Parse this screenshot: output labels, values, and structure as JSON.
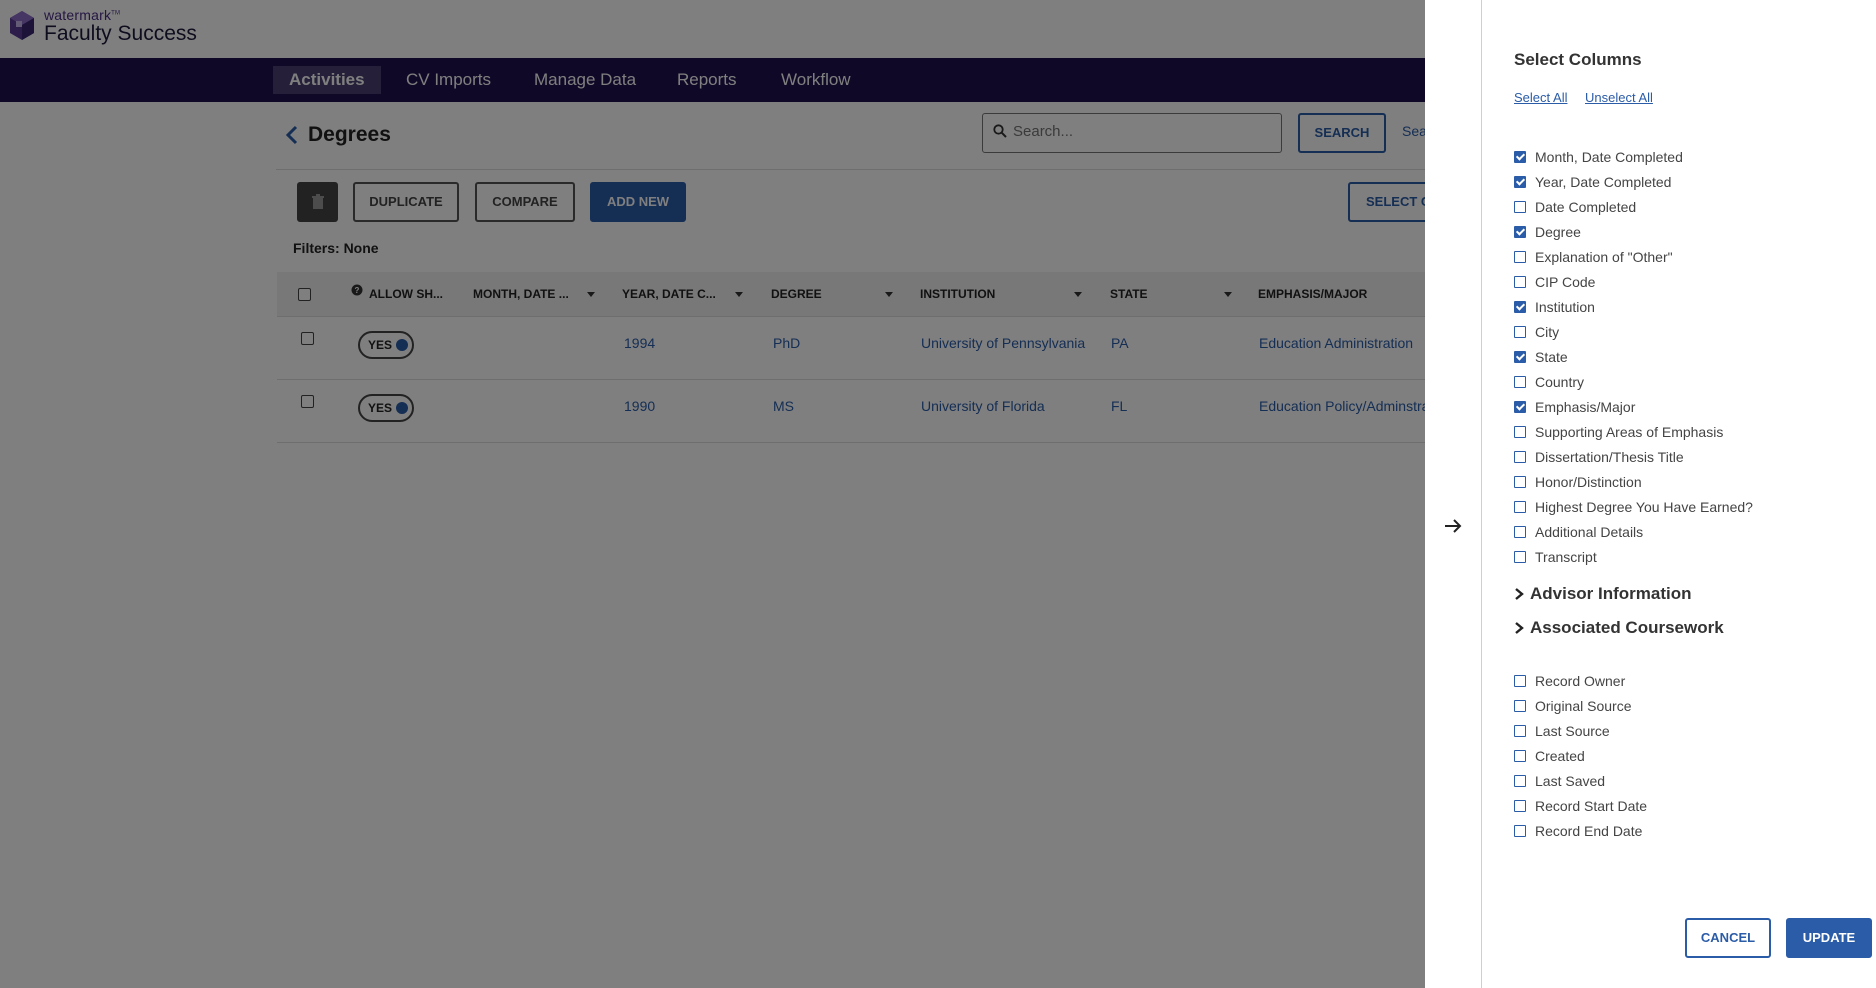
{
  "logo": {
    "small": "watermark",
    "tm": "TM",
    "big": "Faculty Success"
  },
  "nav": [
    {
      "label": "Activities",
      "active": true
    },
    {
      "label": "CV Imports"
    },
    {
      "label": "Manage Data"
    },
    {
      "label": "Reports"
    },
    {
      "label": "Workflow"
    }
  ],
  "page": {
    "title": "Degrees"
  },
  "search": {
    "placeholder": "Search...",
    "button": "SEARCH",
    "link": "Sea"
  },
  "toolbar": {
    "duplicate": "DUPLICATE",
    "compare": "COMPARE",
    "add_new": "ADD NEW",
    "select_columns": "SELECT C"
  },
  "filters": "Filters: None",
  "table": {
    "headers": [
      "ALLOW SH...",
      "MONTH, DATE ...",
      "YEAR, DATE C...",
      "DEGREE",
      "INSTITUTION",
      "STATE",
      "EMPHASIS/MAJOR"
    ],
    "rows": [
      {
        "toggle": "YES",
        "year": "1994",
        "degree": "PhD",
        "institution": "University of Pennsylvania",
        "state": "PA",
        "emphasis": "Education Administration"
      },
      {
        "toggle": "YES",
        "year": "1990",
        "degree": "MS",
        "institution": "University of Florida",
        "state": "FL",
        "emphasis": "Education Policy/Adminstra"
      }
    ]
  },
  "panel": {
    "title": "Select Columns",
    "select_all": "Select All",
    "unselect_all": "Unselect All",
    "columns": [
      {
        "label": "Month, Date Completed",
        "checked": true
      },
      {
        "label": "Year, Date Completed",
        "checked": true
      },
      {
        "label": "Date Completed",
        "checked": false
      },
      {
        "label": "Degree",
        "checked": true
      },
      {
        "label": "Explanation of \"Other\"",
        "checked": false
      },
      {
        "label": "CIP Code",
        "checked": false
      },
      {
        "label": "Institution",
        "checked": true
      },
      {
        "label": "City",
        "checked": false
      },
      {
        "label": "State",
        "checked": true
      },
      {
        "label": "Country",
        "checked": false
      },
      {
        "label": "Emphasis/Major",
        "checked": true
      },
      {
        "label": "Supporting Areas of Emphasis",
        "checked": false
      },
      {
        "label": "Dissertation/Thesis Title",
        "checked": false
      },
      {
        "label": "Honor/Distinction",
        "checked": false
      },
      {
        "label": "Highest Degree You Have Earned?",
        "checked": false
      },
      {
        "label": "Additional Details",
        "checked": false
      },
      {
        "label": "Transcript",
        "checked": false
      }
    ],
    "sections": [
      "Advisor Information",
      "Associated Coursework"
    ],
    "record_columns": [
      {
        "label": "Record Owner",
        "checked": false
      },
      {
        "label": "Original Source",
        "checked": false
      },
      {
        "label": "Last Source",
        "checked": false
      },
      {
        "label": "Created",
        "checked": false
      },
      {
        "label": "Last Saved",
        "checked": false
      },
      {
        "label": "Record Start Date",
        "checked": false
      },
      {
        "label": "Record End Date",
        "checked": false
      }
    ],
    "cancel": "CANCEL",
    "update": "UPDATE"
  },
  "colors": {
    "nav_bg": "#20104f",
    "primary": "#2b5ca8",
    "overlay": "rgba(0,0,0,0.5)"
  }
}
